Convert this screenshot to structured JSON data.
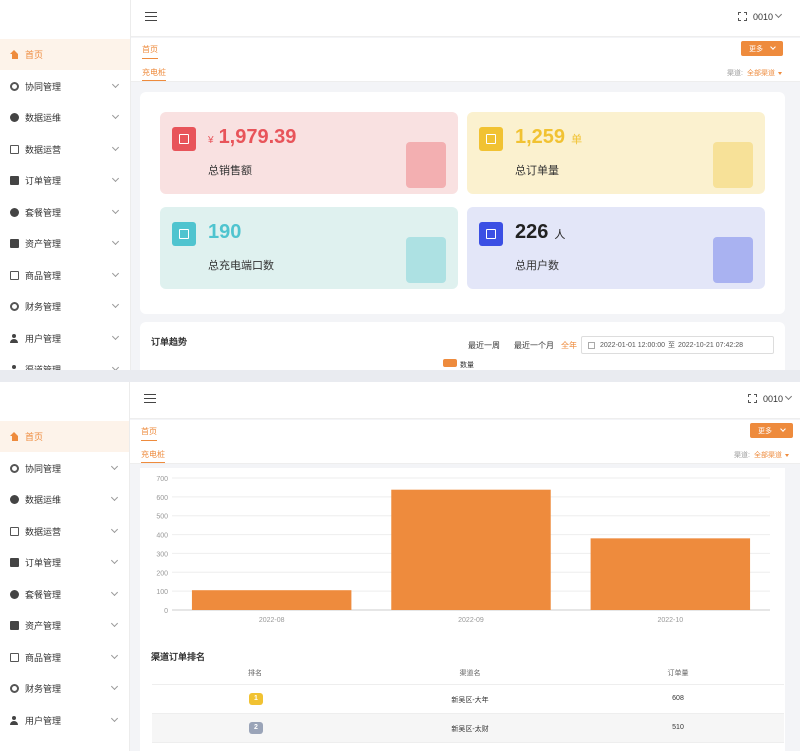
{
  "sidebar": {
    "items": [
      {
        "label": "首页",
        "icon": "home-icon",
        "active": true
      },
      {
        "label": "协同管理",
        "icon": "sync-icon"
      },
      {
        "label": "数据运维",
        "icon": "gear-icon"
      },
      {
        "label": "数据运营",
        "icon": "card-icon"
      },
      {
        "label": "订单管理",
        "icon": "order-icon"
      },
      {
        "label": "套餐管理",
        "icon": "package-icon"
      },
      {
        "label": "资产管理",
        "icon": "building-icon"
      },
      {
        "label": "商品管理",
        "icon": "shop-icon"
      },
      {
        "label": "财务管理",
        "icon": "finance-icon"
      },
      {
        "label": "用户管理",
        "icon": "user-icon"
      },
      {
        "label": "渠道管理",
        "icon": "channel-icon"
      }
    ]
  },
  "header": {
    "user_code": "0010"
  },
  "tabs": {
    "home": "首页",
    "sub": "充电桩",
    "more": "更多",
    "channel_label": "渠道:",
    "channel_value": "全部渠道"
  },
  "stats": [
    {
      "currency": "¥",
      "value": "1,979.39",
      "unit": "",
      "label": "总销售额",
      "color": "#e8545a",
      "bg": "#f9e1e1",
      "icon": "bar-chart-icon"
    },
    {
      "currency": "",
      "value": "1,259",
      "unit": "单",
      "label": "总订单量",
      "color": "#f1c232",
      "bg": "#fbf1cf",
      "icon": "clipboard-icon"
    },
    {
      "currency": "",
      "value": "190",
      "unit": "",
      "label": "总充电端口数",
      "color": "#4fc4cf",
      "bg": "#dff1ef",
      "icon": "battery-icon"
    },
    {
      "currency": "",
      "value": "226",
      "unit": "人",
      "label": "总用户数",
      "color": "#3b4fe4",
      "bg": "#e3e6f8",
      "icon": "person-icon"
    }
  ],
  "trend": {
    "title": "订单趋势",
    "ranges": [
      "最近一周",
      "最近一个月",
      "全年"
    ],
    "selected_range": "全年",
    "date_start": "2022-01-01 12:00:00",
    "date_sep": "至",
    "date_end": "2022-10-21 07:42:28"
  },
  "chart_data": {
    "type": "bar",
    "categories": [
      "2022-08",
      "2022-09",
      "2022-10"
    ],
    "series": [
      {
        "name": "数量",
        "values": [
          105,
          638,
          380
        ],
        "color": "#ee8b3d"
      }
    ],
    "yticks": [
      "0",
      "100",
      "200",
      "300",
      "400",
      "500",
      "600",
      "700"
    ],
    "ylim": [
      0,
      700
    ],
    "grid": true,
    "legend": "top-center"
  },
  "ranking": {
    "title": "渠道订单排名",
    "headers": [
      "排名",
      "渠道名",
      "订单量"
    ],
    "rows": [
      {
        "rank": "1",
        "name": "新吴区-大年",
        "count": "608"
      },
      {
        "rank": "2",
        "name": "新吴区-太财",
        "count": "510"
      }
    ]
  }
}
